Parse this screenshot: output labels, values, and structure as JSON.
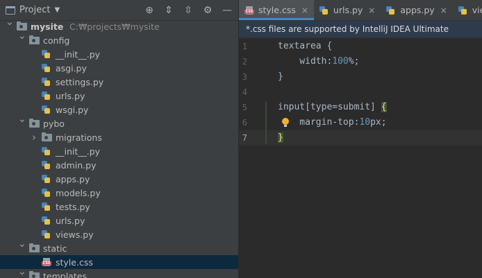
{
  "project_panel": {
    "title": "Project",
    "tools": [
      "target-icon",
      "expand-all-icon",
      "collapse-all-icon",
      "gear-icon",
      "minimize-icon"
    ]
  },
  "tree": [
    {
      "depth": 0,
      "arrow": "down",
      "icon": "folder",
      "label": "mysite",
      "path": "C:₩projects₩mysite",
      "bold": true
    },
    {
      "depth": 1,
      "arrow": "down",
      "icon": "folder",
      "label": "config"
    },
    {
      "depth": 2,
      "arrow": "",
      "icon": "py",
      "label": "__init__.py"
    },
    {
      "depth": 2,
      "arrow": "",
      "icon": "py",
      "label": "asgi.py"
    },
    {
      "depth": 2,
      "arrow": "",
      "icon": "py",
      "label": "settings.py"
    },
    {
      "depth": 2,
      "arrow": "",
      "icon": "py",
      "label": "urls.py"
    },
    {
      "depth": 2,
      "arrow": "",
      "icon": "py",
      "label": "wsgi.py"
    },
    {
      "depth": 1,
      "arrow": "down",
      "icon": "folder",
      "label": "pybo"
    },
    {
      "depth": 2,
      "arrow": "right",
      "icon": "folder",
      "label": "migrations"
    },
    {
      "depth": 2,
      "arrow": "",
      "icon": "py",
      "label": "__init__.py"
    },
    {
      "depth": 2,
      "arrow": "",
      "icon": "py",
      "label": "admin.py"
    },
    {
      "depth": 2,
      "arrow": "",
      "icon": "py",
      "label": "apps.py"
    },
    {
      "depth": 2,
      "arrow": "",
      "icon": "py",
      "label": "models.py"
    },
    {
      "depth": 2,
      "arrow": "",
      "icon": "py",
      "label": "tests.py"
    },
    {
      "depth": 2,
      "arrow": "",
      "icon": "py",
      "label": "urls.py"
    },
    {
      "depth": 2,
      "arrow": "",
      "icon": "py",
      "label": "views.py"
    },
    {
      "depth": 1,
      "arrow": "down",
      "icon": "folder",
      "label": "static"
    },
    {
      "depth": 2,
      "arrow": "",
      "icon": "css",
      "label": "style.css",
      "selected": true
    },
    {
      "depth": 1,
      "arrow": "down",
      "icon": "folder",
      "label": "templates"
    }
  ],
  "tabs": [
    {
      "label": "style.css",
      "icon": "css",
      "active": true,
      "closable": true
    },
    {
      "label": "urls.py",
      "icon": "py",
      "active": false,
      "closable": true
    },
    {
      "label": "apps.py",
      "icon": "py",
      "active": false,
      "closable": true
    },
    {
      "label": "views.py",
      "icon": "py",
      "active": false,
      "closable": false
    }
  ],
  "banner": "*.css files are supported by IntelliJ IDEA Ultimate",
  "editor": {
    "lines": [
      {
        "n": "1",
        "parts": [
          [
            "sel",
            "textarea {"
          ]
        ]
      },
      {
        "n": "2",
        "parts": [
          [
            "prop",
            "    width:"
          ],
          [
            "num",
            "100"
          ],
          [
            "prop",
            "%;"
          ]
        ]
      },
      {
        "n": "3",
        "parts": [
          [
            "sel",
            "}"
          ]
        ]
      },
      {
        "n": "4",
        "parts": []
      },
      {
        "n": "5",
        "parts": [
          [
            "sel",
            "input[type=submit] "
          ],
          [
            "brace-hl",
            "{"
          ]
        ]
      },
      {
        "n": "6",
        "parts": [
          [
            "prop",
            "    margin-top:"
          ],
          [
            "num",
            "10"
          ],
          [
            "prop",
            "px;"
          ]
        ],
        "bulb": true
      },
      {
        "n": "7",
        "parts": [
          [
            "brace-hl",
            "}"
          ]
        ],
        "current": true
      }
    ]
  },
  "colors": {
    "accent": "#4a88c7",
    "selection": "#0d293e",
    "banner_bg": "#2e3b4d"
  }
}
